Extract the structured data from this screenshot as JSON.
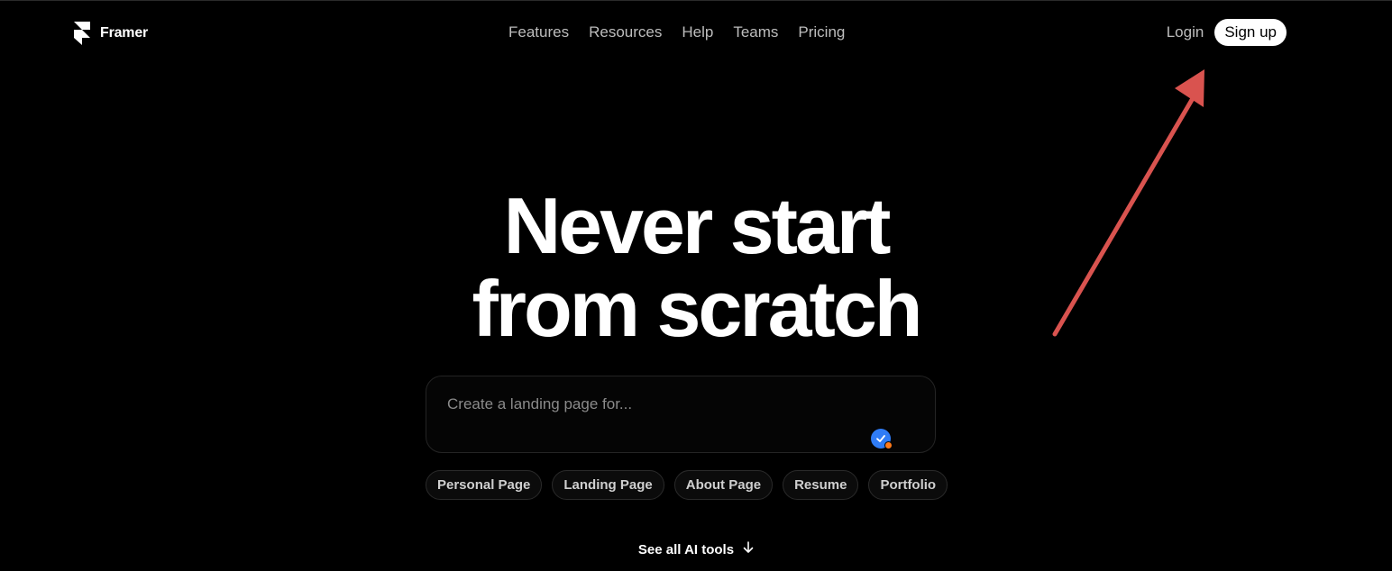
{
  "header": {
    "brand": "Framer",
    "nav": [
      {
        "label": "Features"
      },
      {
        "label": "Resources"
      },
      {
        "label": "Help"
      },
      {
        "label": "Teams"
      },
      {
        "label": "Pricing"
      }
    ],
    "login_label": "Login",
    "signup_label": "Sign up"
  },
  "hero": {
    "title_line1": "Never start",
    "title_line2": "from scratch"
  },
  "prompt": {
    "placeholder": "Create a landing page for...",
    "value": ""
  },
  "chips": [
    {
      "label": "Personal Page"
    },
    {
      "label": "Landing Page"
    },
    {
      "label": "About Page"
    },
    {
      "label": "Resume"
    },
    {
      "label": "Portfolio"
    }
  ],
  "see_all": {
    "label": "See all AI tools"
  },
  "colors": {
    "background": "#000000",
    "annotation_arrow": "#d9534f",
    "badge_blue": "#2f7cf6",
    "badge_orange": "#ff7a1a"
  },
  "icons": {
    "logo": "framer-logo-icon",
    "badge": "check-badge-icon",
    "see_all": "arrow-down-icon"
  }
}
